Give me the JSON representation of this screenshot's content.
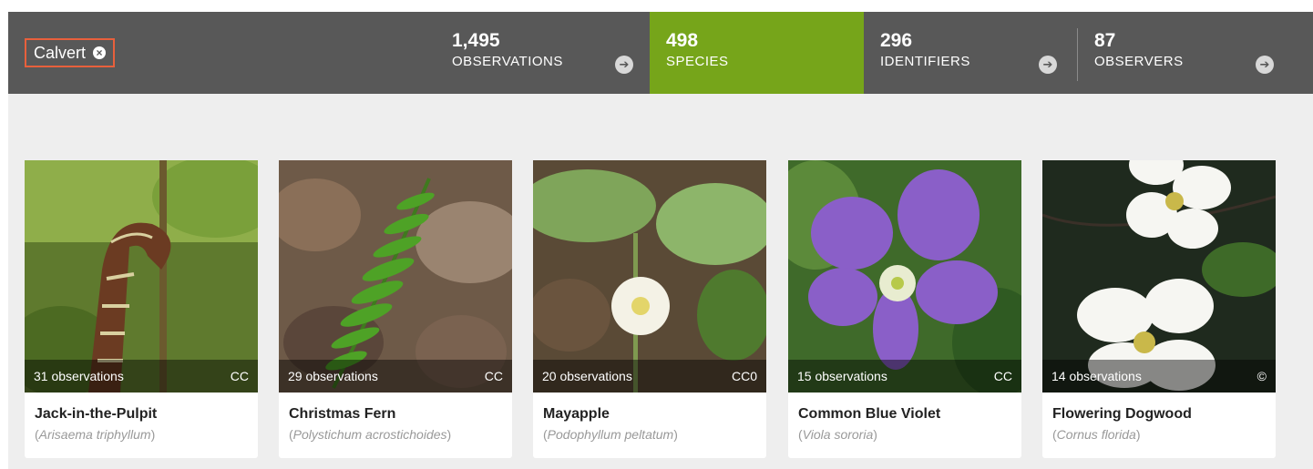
{
  "filter": {
    "place": "Calvert"
  },
  "stats": [
    {
      "count": "1,495",
      "label": "OBSERVATIONS"
    },
    {
      "count": "498",
      "label": "SPECIES"
    },
    {
      "count": "296",
      "label": "IDENTIFIERS"
    },
    {
      "count": "87",
      "label": "OBSERVERS"
    }
  ],
  "colors": {
    "header": "#585858",
    "active": "#76a51a",
    "highlight": "#e8603c"
  },
  "species": [
    {
      "common": "Jack-in-the-Pulpit",
      "scientific": "Arisaema triphyllum",
      "observations": "31 observations",
      "license": "CC"
    },
    {
      "common": "Christmas Fern",
      "scientific": "Polystichum acrostichoides",
      "observations": "29 observations",
      "license": "CC"
    },
    {
      "common": "Mayapple",
      "scientific": "Podophyllum peltatum",
      "observations": "20 observations",
      "license": "CC0"
    },
    {
      "common": "Common Blue Violet",
      "scientific": "Viola sororia",
      "observations": "15 observations",
      "license": "CC"
    },
    {
      "common": "Flowering Dogwood",
      "scientific": "Cornus florida",
      "observations": "14 observations",
      "license": "©"
    }
  ],
  "paren_open": "(",
  "paren_close": ")"
}
